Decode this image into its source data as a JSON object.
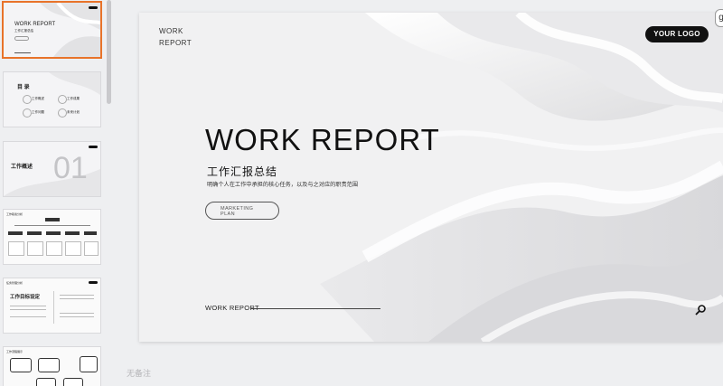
{
  "main_slide": {
    "top_left": "WORK REPORT",
    "logo": "YOUR LOGO",
    "title": "WORK REPORT",
    "subtitle": "工作汇报总结",
    "description": "明确个人在工作中承担的核心任务，以及与之对应的职责范围",
    "pill": "MARKETING PLAN",
    "footer": "WORK REPORT",
    "search_icon": "search-icon"
  },
  "notes_placeholder": "无备注",
  "thumbnails": {
    "t1": {
      "title": "WORK REPORT",
      "subtitle": "工作汇报总结",
      "logo": ""
    },
    "t2": {
      "heading": "目 录",
      "items": [
        "工作概述",
        "工作成果",
        "工作问题",
        "未来计划"
      ]
    },
    "t3": {
      "title": "工作概述",
      "number": "01"
    },
    "t4": {
      "header": "工作职责分析",
      "root": "工作职责"
    },
    "t5": {
      "header": "任务管理分析",
      "title": "工作目标设定"
    },
    "t6": {
      "header": "工作流程展示"
    }
  },
  "colors": {
    "active_border": "#e8732a",
    "accent": "#111111"
  }
}
